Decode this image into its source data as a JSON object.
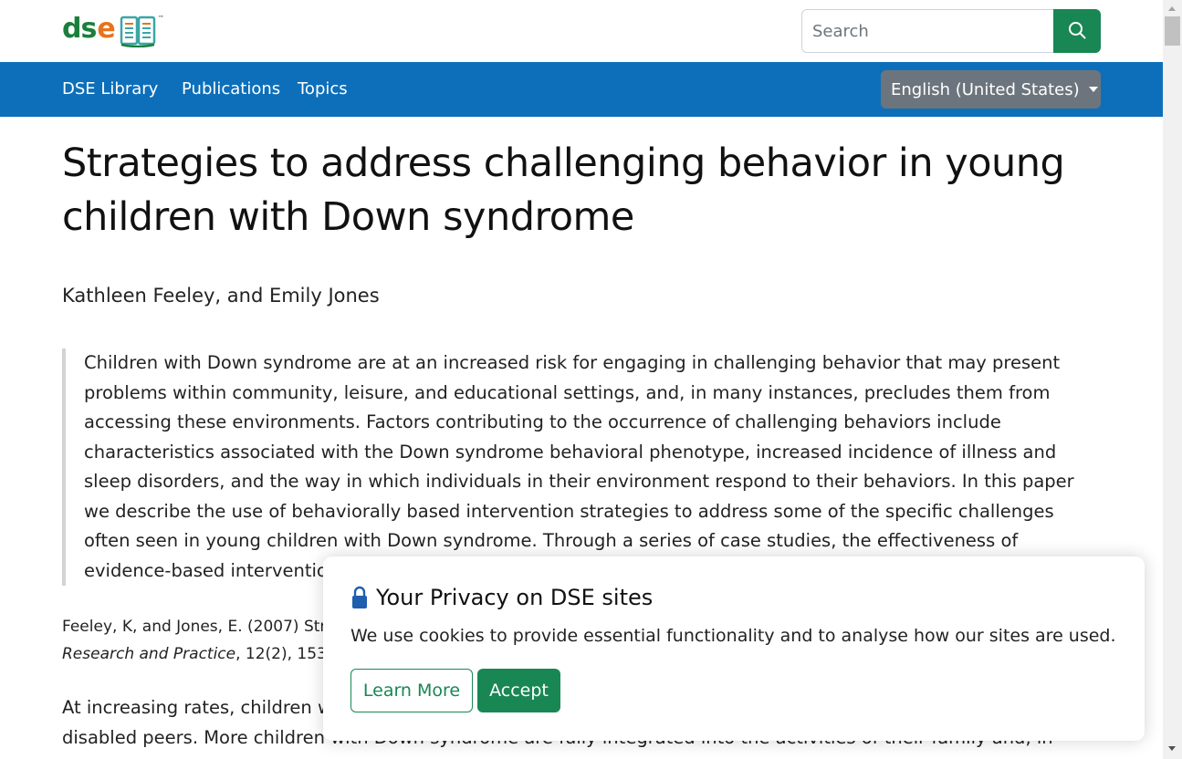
{
  "header": {
    "logo": {
      "text_d": "d",
      "text_s": "s",
      "text_e": "e",
      "tm": "™",
      "colors": {
        "green": "#1a7f3c",
        "orange": "#e8731a",
        "teal": "#3aa6a6"
      }
    },
    "search": {
      "placeholder": "Search",
      "value": "",
      "button_icon": "search-icon"
    }
  },
  "navbar": {
    "background": "#0d6fba",
    "items": [
      {
        "label": "DSE Library"
      },
      {
        "label": "Publications"
      },
      {
        "label": "Topics"
      }
    ],
    "language": {
      "label": "English (United States)",
      "icon": "chevron-down-icon"
    }
  },
  "article": {
    "title": "Strategies to address challenging behavior in young children with Down syndrome",
    "authors": "Kathleen Feeley, and Emily Jones",
    "abstract": "Children with Down syndrome are at an increased risk for engaging in challenging behavior that may present problems within community, leisure, and educational settings, and, in many instances, precludes them from accessing these environments. Factors contributing to the occurrence of challenging behaviors include characteristics associated with the Down syndrome behavioral phenotype, increased incidence of illness and sleep disorders, and the way in which individuals in their environment respond to their behaviors. In this paper we describe the use of behaviorally based intervention strategies to address some of the specific challenges often seen in young children with Down syndrome. Through a series of case studies, the effectiveness of evidence-based interventions addressing challenging behavior is demonstrated.",
    "citation": {
      "line1": "Feeley, K, and Jones, E. (2007) Str",
      "journal": "Research and Practice",
      "rest": ", 12(2), 153-"
    },
    "body_intro_1": "At increasing rates, children wi",
    "body_intro_2": "disabled peers. More children with Down syndrome are fully integrated into the activities of their family and, in many"
  },
  "cookie_banner": {
    "title": "Your Privacy on DSE sites",
    "text": "We use cookies to provide essential functionality and to analyse how our sites are used.",
    "learn_more": "Learn More",
    "accept": "Accept",
    "icon": "lock-icon",
    "accent": "#198754"
  }
}
